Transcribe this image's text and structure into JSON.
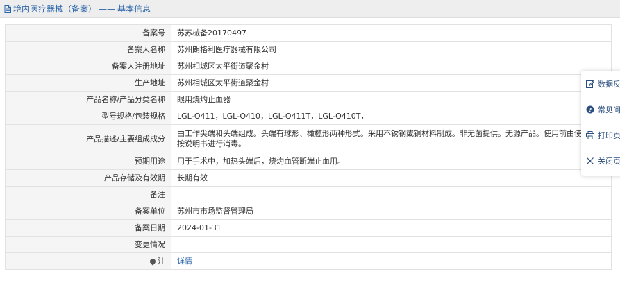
{
  "header": {
    "title": "境内医疗器械（备案）",
    "separator": "——",
    "subtitle": "基本信息"
  },
  "rows": [
    {
      "label": "备案号",
      "value": "苏苏械备20170497"
    },
    {
      "label": "备案人名称",
      "value": "苏州朗格利医疗器械有限公司"
    },
    {
      "label": "备案人注册地址",
      "value": "苏州相城区太平街道聚金村"
    },
    {
      "label": "生产地址",
      "value": "苏州相城区太平街道聚金村"
    },
    {
      "label": "产品名称/产品分类名称",
      "value": "眼用烧灼止血器"
    },
    {
      "label": "型号规格/包装规格",
      "value": "LGL-O411，LGL-O410，LGL-O411T，LGL-O410T，"
    },
    {
      "label": "产品描述/主要组成成分",
      "value": "由工作尖端和头端组成。头端有球形、橄榄形两种形式。采用不锈钢或铜材料制成。非无菌提供。无源产品。使用前由使用机构按说明书进行消毒。"
    },
    {
      "label": "预期用途",
      "value": "用于手术中，加热头端后，烧灼血管断端止血用。"
    },
    {
      "label": "产品存储及有效期",
      "value": "长期有效"
    },
    {
      "label": "备注",
      "value": ""
    },
    {
      "label": "备案单位",
      "value": "苏州市市场监督管理局"
    },
    {
      "label": "备案日期",
      "value": "2024-01-31"
    },
    {
      "label": "变更情况",
      "value": ""
    },
    {
      "label": "注",
      "value": "详情"
    }
  ],
  "side_panel": {
    "items": [
      {
        "label": "数据反",
        "icon": "edit-icon"
      },
      {
        "label": "常见问",
        "icon": "question-icon"
      },
      {
        "label": "打印页",
        "icon": "print-icon"
      },
      {
        "label": "关闭页",
        "icon": "close-icon"
      }
    ]
  },
  "colors": {
    "link": "#2a64a8",
    "label_bg": "#f5f5f5",
    "border": "#e2e2e2",
    "header_bg": "#eeeeee"
  }
}
